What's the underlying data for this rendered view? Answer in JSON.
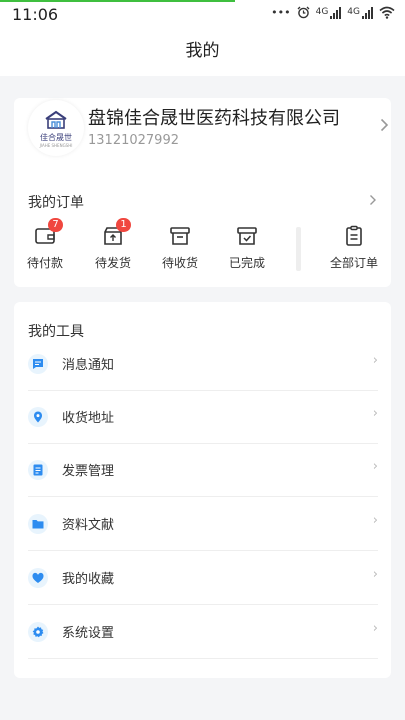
{
  "status_bar": {
    "time": "11:06",
    "dots": "•••",
    "net1": "4G",
    "net2": "4G"
  },
  "nav": {
    "title": "我的"
  },
  "profile": {
    "logo_text": "佳合晟世",
    "logo_sub": "JIAHE SHENGSHI",
    "company": "盘锦佳合晟世医药科技有限公司",
    "phone": "13121027992"
  },
  "orders": {
    "title": "我的订单",
    "items": [
      {
        "label": "待付款",
        "badge": "7",
        "icon": "wallet-icon"
      },
      {
        "label": "待发货",
        "badge": "1",
        "icon": "box-upload-icon"
      },
      {
        "label": "待收货",
        "badge": "",
        "icon": "archive-icon"
      },
      {
        "label": "已完成",
        "badge": "",
        "icon": "archive-check-icon"
      },
      {
        "label": "全部订单",
        "badge": "",
        "icon": "clipboard-icon"
      }
    ]
  },
  "tools": {
    "title": "我的工具",
    "items": [
      {
        "label": "消息通知",
        "icon": "message-icon"
      },
      {
        "label": "收货地址",
        "icon": "location-pin-icon"
      },
      {
        "label": "发票管理",
        "icon": "invoice-icon"
      },
      {
        "label": "资料文献",
        "icon": "folder-icon"
      },
      {
        "label": "我的收藏",
        "icon": "heart-icon"
      },
      {
        "label": "系统设置",
        "icon": "gear-icon"
      }
    ]
  },
  "colors": {
    "accent": "#2d8cf0",
    "badge": "#f0473f",
    "progress": "#3fbf3f",
    "background": "#f4f5f7"
  }
}
